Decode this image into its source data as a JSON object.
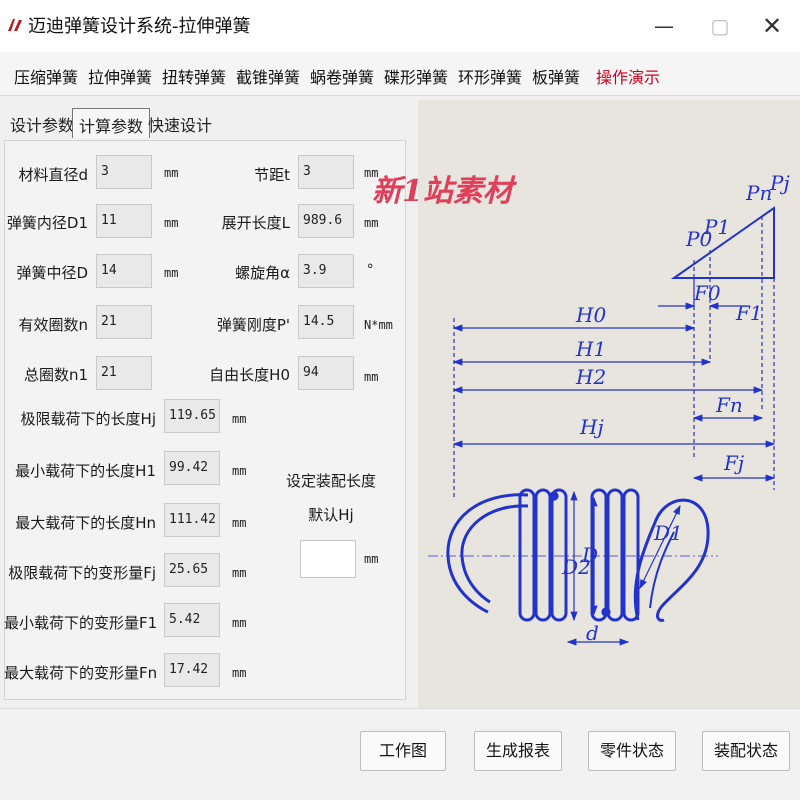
{
  "window": {
    "title": "迈迪弹簧设计系统-拉伸弹簧",
    "minimize_glyph": "—",
    "maximize_glyph": "▢",
    "close_glyph": "✕"
  },
  "menu": [
    {
      "label": "压缩弹簧"
    },
    {
      "label": "拉伸弹簧"
    },
    {
      "label": "扭转弹簧"
    },
    {
      "label": "截锥弹簧"
    },
    {
      "label": "蜗卷弹簧"
    },
    {
      "label": "碟形弹簧"
    },
    {
      "label": "环形弹簧"
    },
    {
      "label": "板弹簧"
    },
    {
      "label": "操作演示",
      "color": "#d0021b"
    }
  ],
  "tabs": [
    {
      "label": "设计参数"
    },
    {
      "label": "计算参数",
      "selected": true
    },
    {
      "label": "快速设计"
    }
  ],
  "params": {
    "wire_diameter": {
      "label": "材料直径d",
      "value": "3",
      "unit": "mm"
    },
    "inner_diameter": {
      "label": "弹簧内径D1",
      "value": "11",
      "unit": "mm"
    },
    "mean_diameter": {
      "label": "弹簧中径D",
      "value": "14",
      "unit": "mm"
    },
    "active_coils": {
      "label": "有效圈数n",
      "value": "21"
    },
    "total_coils": {
      "label": "总圈数n1",
      "value": "21"
    },
    "pitch": {
      "label": "节距t",
      "value": "3",
      "unit": "mm"
    },
    "developed_length": {
      "label": "展开长度L",
      "value": "989.6",
      "unit": "mm"
    },
    "helix_angle": {
      "label": "螺旋角α",
      "value": "3.9",
      "unit": "°"
    },
    "stiffness": {
      "label": "弹簧刚度P'",
      "value": "14.5",
      "unit": "N*mm"
    },
    "free_length": {
      "label": "自由长度H0",
      "value": "94",
      "unit": "mm"
    },
    "limit_load_length": {
      "label": "极限载荷下的长度Hj",
      "value": "119.65",
      "unit": "mm"
    },
    "min_load_length": {
      "label": "最小载荷下的长度H1",
      "value": "99.42",
      "unit": "mm"
    },
    "max_load_length": {
      "label": "最大载荷下的长度Hn",
      "value": "111.42",
      "unit": "mm"
    },
    "limit_load_deform": {
      "label": "极限载荷下的变形量Fj",
      "value": "25.65",
      "unit": "mm"
    },
    "min_load_deform": {
      "label": "最小载荷下的变形量F1",
      "value": "5.42",
      "unit": "mm"
    },
    "max_load_deform": {
      "label": "最大载荷下的变形量Fn",
      "value": "17.42",
      "unit": "mm"
    }
  },
  "assembly": {
    "label_line1": "设定装配长度",
    "label_line2": "默认Hj",
    "value": "",
    "unit": "mm"
  },
  "diagram_labels": {
    "P0": "P0",
    "P1": "P1",
    "Pn": "Pn",
    "Pj": "Pj",
    "F0": "F0",
    "F1": "F1",
    "Fn": "Fn",
    "Fj": "Fj",
    "H0": "H0",
    "H1": "H1",
    "H2": "H2",
    "Hj": "Hj",
    "D": "D",
    "D1": "D1",
    "D2": "D2",
    "d": "d"
  },
  "watermark": "新1站素材",
  "buttons": [
    {
      "label": "工作图"
    },
    {
      "label": "生成报表"
    },
    {
      "label": "零件状态"
    },
    {
      "label": "装配状态"
    }
  ],
  "colors": {
    "accent_red": "#d0021b",
    "diagram_blue": "#2233cc",
    "watermark": "#e03f5a"
  }
}
